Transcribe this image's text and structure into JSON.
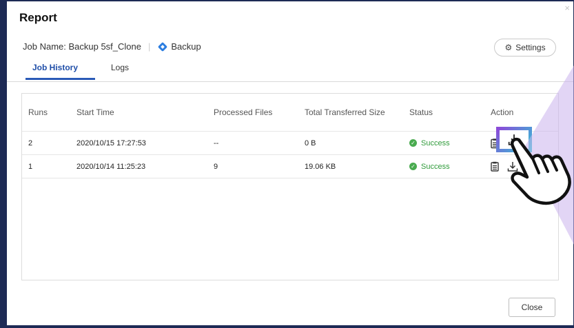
{
  "dialog": {
    "title": "Report",
    "close_glyph": "×",
    "job_label": "Job Name: Backup 5sf_Clone",
    "separator": "|",
    "job_type": "Backup",
    "settings_label": "Settings",
    "close_button": "Close"
  },
  "tabs": [
    {
      "label": "Job History",
      "active": true
    },
    {
      "label": "Logs",
      "active": false
    }
  ],
  "table": {
    "headers": [
      "Runs",
      "Start Time",
      "Processed Files",
      "Total Transferred Size",
      "Status",
      "Action"
    ],
    "rows": [
      {
        "runs": "2",
        "start": "2020/10/15 17:27:53",
        "files": "--",
        "size": "0 B",
        "status": "Success"
      },
      {
        "runs": "1",
        "start": "2020/10/14 11:25:23",
        "files": "9",
        "size": "19.06 KB",
        "status": "Success"
      }
    ]
  },
  "colors": {
    "accent": "#2a5ab7",
    "success": "#49ab4f",
    "backdrop": "#1d2a55",
    "highlight_from": "#8b4bd8",
    "highlight_to": "#2ec8d6"
  },
  "icons": [
    "gear-icon",
    "backup-diamond-icon",
    "check-icon",
    "clipboard-icon",
    "download-icon",
    "hand-pointer-icon"
  ]
}
